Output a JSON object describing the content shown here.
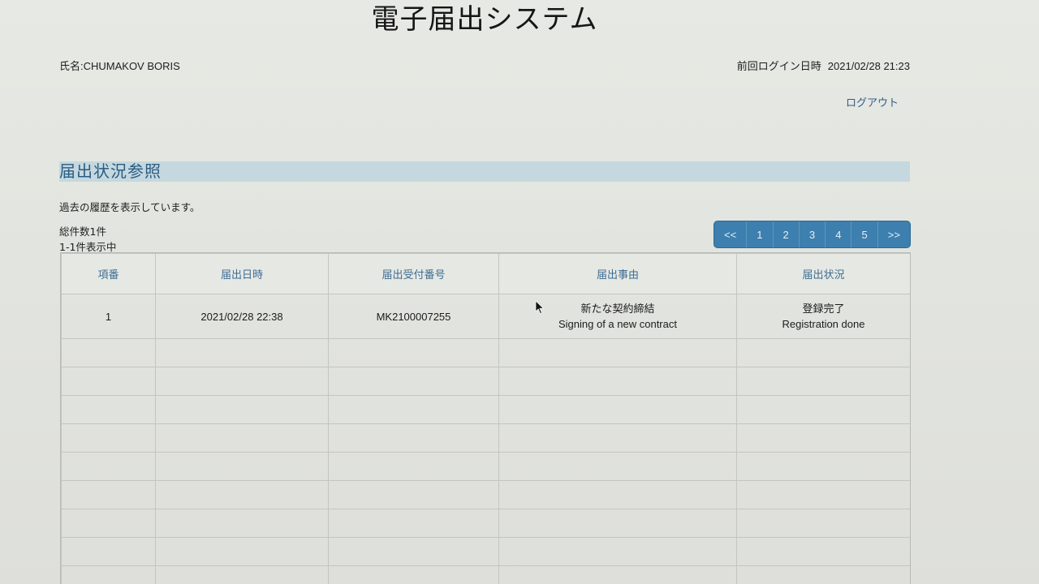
{
  "header": {
    "system_title": "電子届出システム",
    "user_name": "氏名:CHUMAKOV BORIS",
    "last_login_label": "前回ログイン日時",
    "last_login_value": "2021/02/28 21:23",
    "logout_label": "ログアウト"
  },
  "section": {
    "title": "届出状況参照",
    "description": "過去の履歴を表示しています。",
    "total_count": "総件数1件",
    "range_display": "1-1件表示中"
  },
  "pagination": {
    "items": [
      "<<",
      "1",
      "2",
      "3",
      "4",
      "5",
      ">>"
    ]
  },
  "table": {
    "columns": [
      "項番",
      "届出日時",
      "届出受付番号",
      "届出事由",
      "届出状況"
    ],
    "rows": [
      {
        "index": "1",
        "datetime": "2021/02/28 22:38",
        "receipt_number": "MK2100007255",
        "reason_ja": "新たな契約締結",
        "reason_en": "Signing of a new contract",
        "status_ja": "登録完了",
        "status_en": "Registration done"
      }
    ]
  },
  "colors": {
    "section_header_bg": "#c5d8df",
    "accent_blue": "#2a5d83",
    "pagination_bg": "#3d7fae"
  },
  "icons": {
    "cursor": "mouse-pointer-icon"
  }
}
